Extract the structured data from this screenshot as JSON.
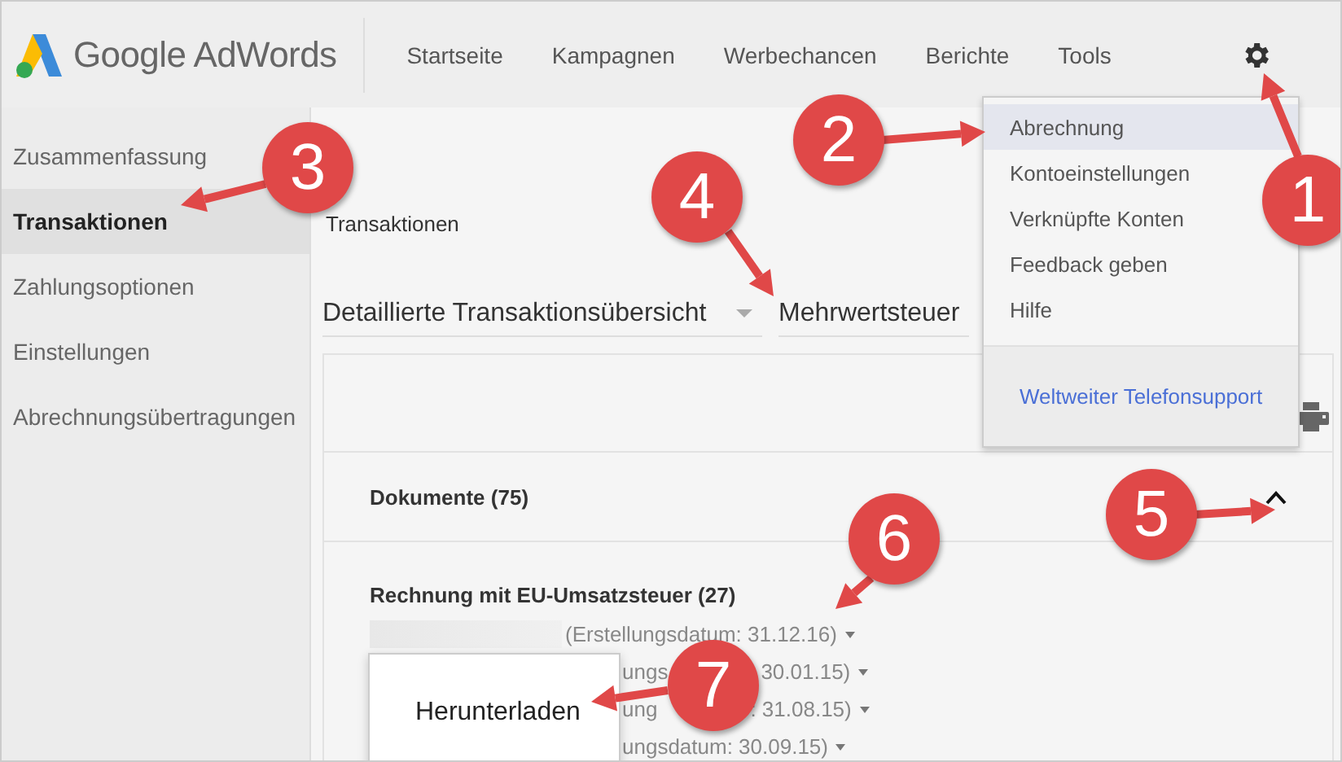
{
  "header": {
    "logo": "Google AdWords",
    "nav": [
      {
        "label": "Startseite"
      },
      {
        "label": "Kampagnen"
      },
      {
        "label": "Werbechancen"
      },
      {
        "label": "Berichte"
      },
      {
        "label": "Tools"
      }
    ]
  },
  "sidebar": {
    "items": [
      {
        "label": "Zusammenfassung",
        "selected": false
      },
      {
        "label": "Transaktionen",
        "selected": true
      },
      {
        "label": "Zahlungsoptionen",
        "selected": false
      },
      {
        "label": "Einstellungen",
        "selected": false
      },
      {
        "label": "Abrechnungsübertragungen",
        "selected": false
      }
    ]
  },
  "breadcrumb": "Transaktionen",
  "filters": [
    {
      "label": "Detaillierte Transaktionsübersicht",
      "dropdown": true
    },
    {
      "label": "Mehrwertsteuer",
      "dropdown": false
    }
  ],
  "documents": {
    "title": "Dokumente (75)",
    "expanded": true,
    "group": "Rechnung mit EU-Umsatzsteuer (27)",
    "rows": [
      {
        "parts": [
          "(Erstellungsdatum: 31.12.16)"
        ],
        "redacted": true
      },
      {
        "parts": [
          "ungs",
          "30.01.15)"
        ],
        "redacted": false
      },
      {
        "parts": [
          "ung",
          ": 31.08.15)"
        ],
        "redacted": false
      },
      {
        "parts": [
          "ungsdatum: 30.09.15)"
        ],
        "redacted": false
      }
    ]
  },
  "download_popup": {
    "label": "Herunterladen"
  },
  "settings_menu": {
    "items": [
      {
        "label": "Abrechnung",
        "selected": true
      },
      {
        "label": "Kontoeinstellungen",
        "selected": false
      },
      {
        "label": "Verknüpfte Konten",
        "selected": false
      },
      {
        "label": "Feedback geben",
        "selected": false
      },
      {
        "label": "Hilfe",
        "selected": false
      }
    ],
    "link": "Weltweiter Telefonsupport"
  },
  "callouts": [
    "1",
    "2",
    "3",
    "4",
    "5",
    "6",
    "7"
  ]
}
